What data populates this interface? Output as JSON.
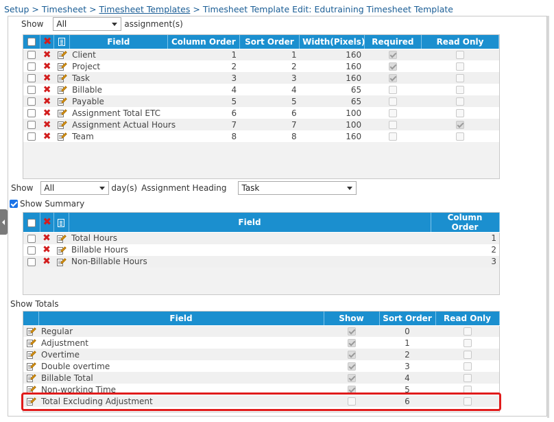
{
  "breadcrumb": {
    "setup": "Setup",
    "sep1": " > ",
    "timesheet": "Timesheet",
    "sep2": " > ",
    "templates": "Timesheet Templates",
    "sep3": " > ",
    "current": "Timesheet Template Edit: Edutraining Timesheet Template"
  },
  "assignments": {
    "show_label": "Show",
    "show_value": "All",
    "suffix": "assignment(s)",
    "columns": [
      "Field",
      "Column Order",
      "Sort Order",
      "Width(Pixels)",
      "Required",
      "Read Only"
    ],
    "rows": [
      {
        "field": "Client",
        "col": "1",
        "sort": "1",
        "width": "160",
        "required": true,
        "readonly": false
      },
      {
        "field": "Project",
        "col": "2",
        "sort": "2",
        "width": "160",
        "required": true,
        "readonly": false
      },
      {
        "field": "Task",
        "col": "3",
        "sort": "3",
        "width": "160",
        "required": true,
        "readonly": false
      },
      {
        "field": "Billable",
        "col": "4",
        "sort": "4",
        "width": "65",
        "required": false,
        "readonly": false
      },
      {
        "field": "Payable",
        "col": "5",
        "sort": "5",
        "width": "65",
        "required": false,
        "readonly": false
      },
      {
        "field": "Assignment Total ETC",
        "col": "6",
        "sort": "6",
        "width": "100",
        "required": false,
        "readonly": false
      },
      {
        "field": "Assignment Actual Hours",
        "col": "7",
        "sort": "7",
        "width": "100",
        "required": false,
        "readonly": true
      },
      {
        "field": "Team",
        "col": "8",
        "sort": "8",
        "width": "160",
        "required": false,
        "readonly": false
      }
    ]
  },
  "days": {
    "show_label": "Show",
    "show_value": "All",
    "suffix": "day(s)",
    "heading_label": "Assignment Heading",
    "heading_value": "Task"
  },
  "summary": {
    "show_label": "Show Summary",
    "checked": true,
    "columns": [
      "Field",
      "Column Order"
    ],
    "rows": [
      {
        "field": "Total Hours",
        "col": "1"
      },
      {
        "field": "Billable Hours",
        "col": "2"
      },
      {
        "field": "Non-Billable Hours",
        "col": "3"
      }
    ]
  },
  "totals": {
    "label": "Show Totals",
    "columns": [
      "Field",
      "Show",
      "Sort Order",
      "Read Only"
    ],
    "rows": [
      {
        "field": "Regular",
        "show": true,
        "sort": "0",
        "readonly": false
      },
      {
        "field": "Adjustment",
        "show": true,
        "sort": "1",
        "readonly": false
      },
      {
        "field": "Overtime",
        "show": true,
        "sort": "2",
        "readonly": false
      },
      {
        "field": "Double overtime",
        "show": true,
        "sort": "3",
        "readonly": false
      },
      {
        "field": "Billable Total",
        "show": true,
        "sort": "4",
        "readonly": false
      },
      {
        "field": "Non-working Time",
        "show": true,
        "sort": "5",
        "readonly": false
      },
      {
        "field": "Total Excluding Adjustment",
        "show": false,
        "sort": "6",
        "readonly": false
      }
    ]
  },
  "colors": {
    "header_blue": "#1b8fcf",
    "link_blue": "#1a5d95",
    "highlight_red": "#e01b1b",
    "delete_red": "#d21d1d"
  },
  "icons": [
    "delete-icon",
    "edit-icon",
    "list-icon",
    "chevron-down-icon",
    "collapse-arrow-icon"
  ]
}
